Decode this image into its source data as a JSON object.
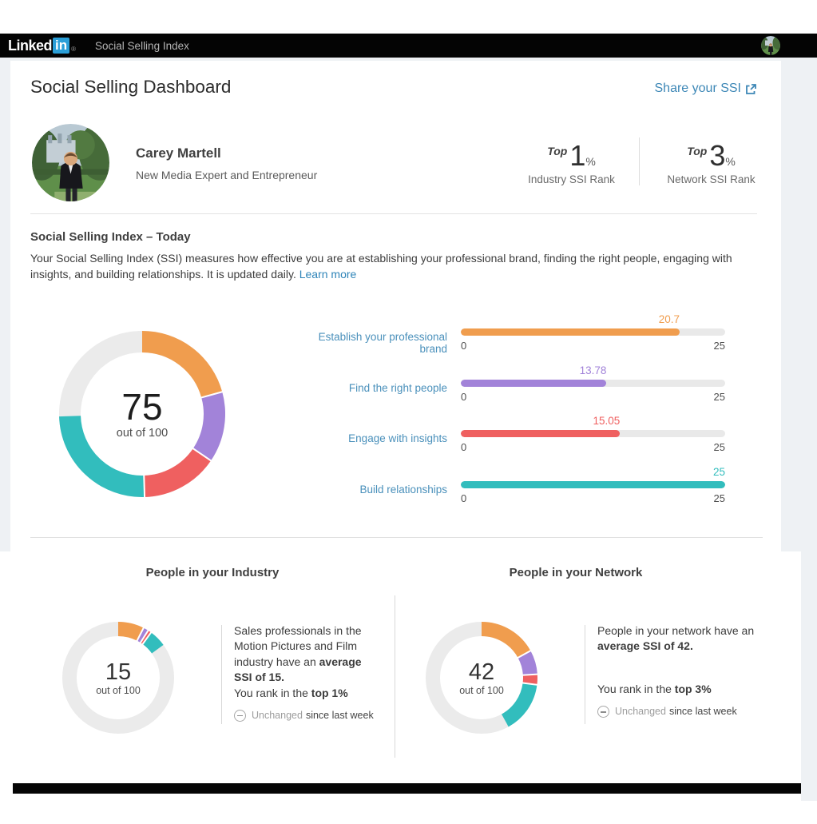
{
  "nav": {
    "logo_linked": "Linked",
    "logo_in": "in",
    "registered": "®",
    "title": "Social Selling Index"
  },
  "header": {
    "title": "Social Selling Dashboard",
    "share_label": "Share your SSI"
  },
  "profile": {
    "name": "Carey Martell",
    "headline": "New Media Expert and Entrepreneur",
    "ranks": [
      {
        "prefix": "Top",
        "value": "1",
        "suffix": "%",
        "label": "Industry SSI Rank"
      },
      {
        "prefix": "Top",
        "value": "3",
        "suffix": "%",
        "label": "Network SSI Rank"
      }
    ]
  },
  "today": {
    "heading": "Social Selling Index – Today",
    "description": "Your Social Selling Index (SSI) measures how effective you are at establishing your professional brand, finding the right people, engaging with insights, and building relationships. It is updated daily. ",
    "learn_more": "Learn more"
  },
  "colors": {
    "brand_blue": "#2b9fd8",
    "link_blue": "#2e84b8",
    "bar_label_blue": "#4a90bb",
    "orange": "#f09d4e",
    "purple": "#a283d9",
    "red": "#ef6060",
    "teal": "#32bdbd",
    "track_gray": "#ebebeb"
  },
  "donut_main": {
    "score": "75",
    "caption": "out of 100",
    "max": 100,
    "track_color": "#ebebeb",
    "segments": [
      {
        "name": "Establish your professional brand",
        "value": 20.7,
        "color": "#f09d4e"
      },
      {
        "name": "Find the right people",
        "value": 13.78,
        "color": "#a283d9"
      },
      {
        "name": "Engage with insights",
        "value": 15.05,
        "color": "#ef6060"
      },
      {
        "name": "Build relationships",
        "value": 25,
        "color": "#32bdbd"
      }
    ]
  },
  "bar_chart": {
    "max": 25,
    "scale_min": "0",
    "scale_max": "25",
    "track_color": "#e9e9e9",
    "label_color": "#4a90bb",
    "items": [
      {
        "label": "Establish your professional brand",
        "value": 20.7,
        "display": "20.7",
        "color": "#f09d4e"
      },
      {
        "label": "Find the right people",
        "value": 13.78,
        "display": "13.78",
        "color": "#a283d9"
      },
      {
        "label": "Engage with insights",
        "value": 15.05,
        "display": "15.05",
        "color": "#ef6060"
      },
      {
        "label": "Build relationships",
        "value": 25,
        "display": "25",
        "color": "#32bdbd"
      }
    ]
  },
  "industry": {
    "heading": "People in your Industry",
    "donut": {
      "score": "15",
      "caption": "out of 100",
      "max": 100,
      "track_color": "#ebebeb",
      "segments": [
        {
          "name": "Establish your professional brand",
          "value": 7.5,
          "color": "#f09d4e"
        },
        {
          "name": "Find the right people",
          "value": 1.5,
          "color": "#a283d9"
        },
        {
          "name": "Engage with insights",
          "value": 1,
          "color": "#ef6060"
        },
        {
          "name": "Build relationships",
          "value": 5,
          "color": "#32bdbd"
        }
      ]
    },
    "text_normal": "Sales professionals in the Motion Pictures and Film industry have an ",
    "text_bold": "average SSI of 15.",
    "rank_normal": "You rank in the ",
    "rank_bold": "top 1%",
    "change_muted": "Unchanged",
    "change_rest": " since last week"
  },
  "network": {
    "heading": "People in your Network",
    "donut": {
      "score": "42",
      "caption": "out of 100",
      "max": 100,
      "track_color": "#ebebeb",
      "segments": [
        {
          "name": "Establish your professional brand",
          "value": 17,
          "color": "#f09d4e"
        },
        {
          "name": "Find the right people",
          "value": 7,
          "color": "#a283d9"
        },
        {
          "name": "Engage with insights",
          "value": 3,
          "color": "#ef6060"
        },
        {
          "name": "Build relationships",
          "value": 15,
          "color": "#32bdbd"
        }
      ]
    },
    "text_normal": "People in your network have an ",
    "text_bold": "average SSI of 42.",
    "rank_normal": "You rank in the ",
    "rank_bold": "top 3%",
    "change_muted": "Unchanged",
    "change_rest": " since last week"
  },
  "chart_data": [
    {
      "type": "donut",
      "title": "Social Selling Index – Today",
      "score": 75,
      "score_caption": "out of 100",
      "max": 100,
      "segments": [
        {
          "label": "Establish your professional brand",
          "value": 20.7
        },
        {
          "label": "Find the right people",
          "value": 13.78
        },
        {
          "label": "Engage with insights",
          "value": 15.05
        },
        {
          "label": "Build relationships",
          "value": 25
        }
      ]
    },
    {
      "type": "bar",
      "title": "SSI component scores",
      "categories": [
        "Establish your professional brand",
        "Find the right people",
        "Engage with insights",
        "Build relationships"
      ],
      "values": [
        20.7,
        13.78,
        15.05,
        25
      ],
      "xlim": [
        0,
        25
      ],
      "xlabel": "",
      "ylabel": ""
    },
    {
      "type": "donut",
      "title": "People in your Industry",
      "score": 15,
      "score_caption": "out of 100",
      "max": 100,
      "segments": [
        {
          "label": "Establish your professional brand",
          "value": 7.5
        },
        {
          "label": "Find the right people",
          "value": 1.5
        },
        {
          "label": "Engage with insights",
          "value": 1
        },
        {
          "label": "Build relationships",
          "value": 5
        }
      ]
    },
    {
      "type": "donut",
      "title": "People in your Network",
      "score": 42,
      "score_caption": "out of 100",
      "max": 100,
      "segments": [
        {
          "label": "Establish your professional brand",
          "value": 17
        },
        {
          "label": "Find the right people",
          "value": 7
        },
        {
          "label": "Engage with insights",
          "value": 3
        },
        {
          "label": "Build relationships",
          "value": 15
        }
      ]
    }
  ]
}
